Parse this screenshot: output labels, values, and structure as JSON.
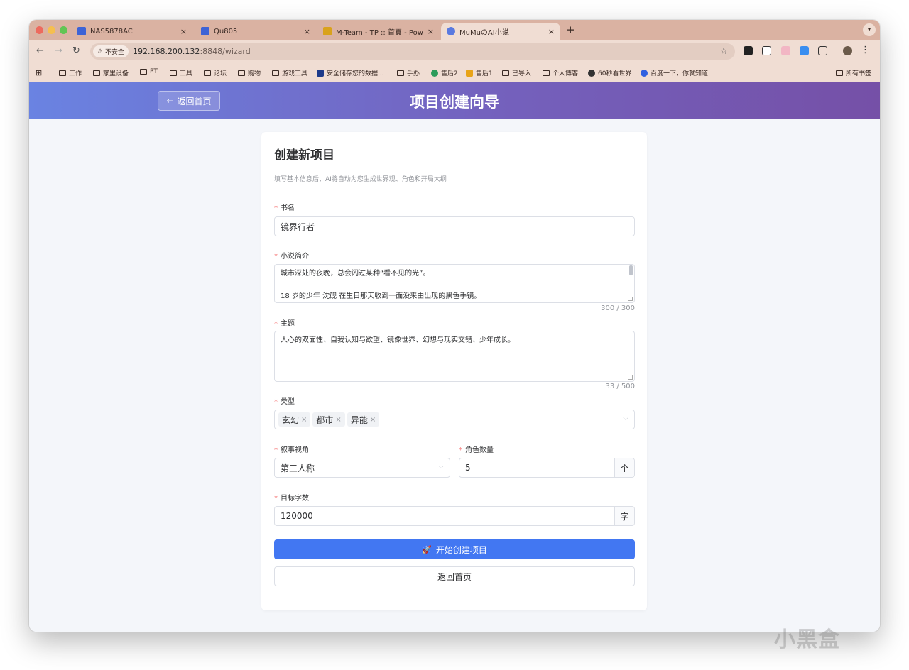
{
  "browser": {
    "tabs": [
      {
        "title": "NAS5878AC",
        "favicon_color": "#3d63d6",
        "active": false
      },
      {
        "title": "Qu805",
        "favicon_color": "#3d63d6",
        "active": false
      },
      {
        "title": "M-Team - TP :: 首頁 - Powere",
        "favicon_color": "#d9a21c",
        "active": false
      },
      {
        "title": "MuMuのAI小说",
        "favicon_color": "#5a7ae0",
        "active": true
      }
    ],
    "close_glyph": "×",
    "new_tab_glyph": "+",
    "address": {
      "security_label": "不安全",
      "url_host": "192.168.200.132",
      "url_rest": ":8848/wizard"
    },
    "bookmarks": [
      {
        "label": "工作",
        "kind": "folder"
      },
      {
        "label": "家里设备",
        "kind": "folder"
      },
      {
        "label": "PT",
        "kind": "folder"
      },
      {
        "label": "工具",
        "kind": "folder"
      },
      {
        "label": "论坛",
        "kind": "folder"
      },
      {
        "label": "购物",
        "kind": "folder"
      },
      {
        "label": "游戏工具",
        "kind": "folder"
      },
      {
        "label": "安全储存您的数据...",
        "kind": "site",
        "color": "#1d3a8a"
      },
      {
        "label": "手办",
        "kind": "folder"
      },
      {
        "label": "售后2",
        "kind": "site",
        "color": "#2d9c5b"
      },
      {
        "label": "售后1",
        "kind": "site",
        "color": "#e8a317"
      },
      {
        "label": "已导入",
        "kind": "folder"
      },
      {
        "label": "个人博客",
        "kind": "folder"
      },
      {
        "label": "60秒看世界",
        "kind": "site",
        "color": "#333333"
      },
      {
        "label": "百度一下，你就知道",
        "kind": "site",
        "color": "#3060e0"
      }
    ],
    "all_bookmarks_label": "所有书签"
  },
  "header": {
    "back_label": "返回首页",
    "title": "项目创建向导"
  },
  "card": {
    "title": "创建新项目",
    "description": "填写基本信息后，AI将自动为您生成世界观、角色和开局大纲"
  },
  "form": {
    "required_mark": "*",
    "book_name": {
      "label": "书名",
      "value": "镜界行者"
    },
    "synopsis": {
      "label": "小说简介",
      "line1": "城市深处的夜晚，总会闪过某种“看不见的光”。",
      "line2": "18 岁的少年 沈砚 在生日那天收到一面没来由出现的黑色手镜。",
      "counter": "300 / 300"
    },
    "theme": {
      "label": "主题",
      "value": "人心的双面性、自我认知与欲望、镜像世界、幻想与现实交错、少年成长。",
      "counter": "33 / 500"
    },
    "genre": {
      "label": "类型",
      "tags": [
        "玄幻",
        "都市",
        "异能"
      ]
    },
    "narrative": {
      "label": "叙事视角",
      "value": "第三人称"
    },
    "character_count": {
      "label": "角色数量",
      "value": "5",
      "addon": "个"
    },
    "target_words": {
      "label": "目标字数",
      "value": "120000",
      "addon": "字"
    }
  },
  "actions": {
    "primary": "开始创建项目",
    "secondary": "返回首页"
  },
  "watermark": "小黑盒",
  "colors": {
    "primary": "#4277f2",
    "header_from": "#6a83e2",
    "header_to": "#7550a7",
    "required": "#f56c6c"
  }
}
